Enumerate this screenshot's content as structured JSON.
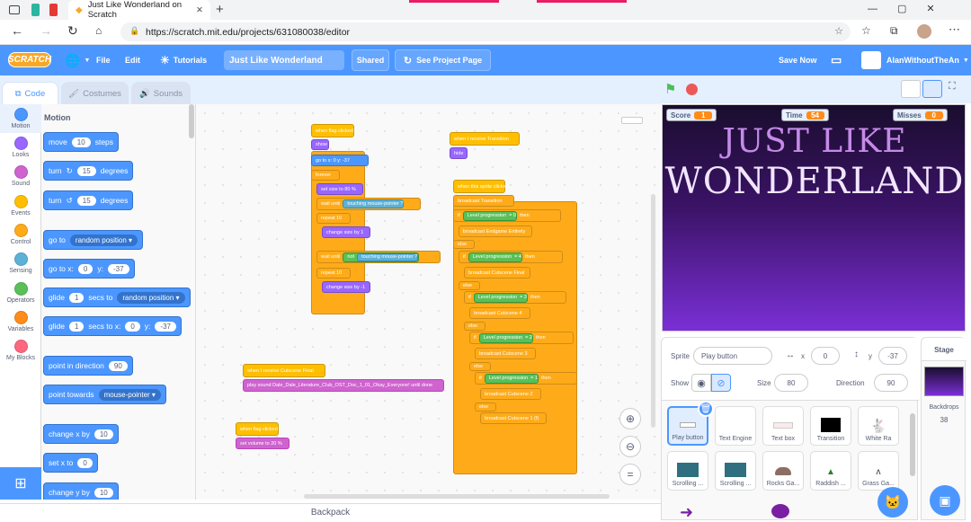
{
  "browser": {
    "tab_title": "Just Like Wonderland on Scratch",
    "url": "https://scratch.mit.edu/projects/631080038/editor"
  },
  "menu": {
    "file": "File",
    "edit": "Edit",
    "tutorials": "Tutorials",
    "project_title": "Just Like Wonderland",
    "shared": "Shared",
    "see_project": "See Project Page",
    "save_now": "Save Now",
    "username": "AlanWithoutTheAn"
  },
  "tabs": {
    "code": "Code",
    "costumes": "Costumes",
    "sounds": "Sounds"
  },
  "categories": [
    {
      "label": "Motion",
      "color": "#4c97ff"
    },
    {
      "label": "Looks",
      "color": "#9966ff"
    },
    {
      "label": "Sound",
      "color": "#cf63cf"
    },
    {
      "label": "Events",
      "color": "#ffbf00"
    },
    {
      "label": "Control",
      "color": "#ffab19"
    },
    {
      "label": "Sensing",
      "color": "#5cb1d6"
    },
    {
      "label": "Operators",
      "color": "#59c059"
    },
    {
      "label": "Variables",
      "color": "#ff8c1a"
    },
    {
      "label": "My Blocks",
      "color": "#ff6680"
    }
  ],
  "palette": {
    "heading": "Motion",
    "move": {
      "a": "move",
      "v": "10",
      "b": "steps"
    },
    "turn_right": {
      "a": "turn",
      "v": "15",
      "b": "degrees"
    },
    "turn_left": {
      "a": "turn",
      "v": "15",
      "b": "degrees"
    },
    "goto": {
      "a": "go to",
      "d": "random position"
    },
    "gotoxy": {
      "a": "go to x:",
      "x": "0",
      "b": "y:",
      "y": "-37"
    },
    "glide_to": {
      "a": "glide",
      "v": "1",
      "b": "secs to",
      "d": "random position"
    },
    "glide_xy": {
      "a": "glide",
      "v": "1",
      "b": "secs to x:",
      "x": "0",
      "c": "y:",
      "y": "-37"
    },
    "point_dir": {
      "a": "point in direction",
      "v": "90"
    },
    "point_towards": {
      "a": "point towards",
      "d": "mouse-pointer"
    },
    "change_x": {
      "a": "change x by",
      "v": "10"
    },
    "set_x": {
      "a": "set x to",
      "v": "0"
    },
    "change_y": {
      "a": "change y by",
      "v": "10"
    }
  },
  "scripts": {
    "s1": [
      "when flag clicked",
      "show",
      "go to x: 0 y: -37",
      "forever",
      "set size to 80 %",
      "wait until",
      "touching mouse-pointer ?",
      "repeat 10",
      "change size by 1",
      "wait until",
      "not",
      "touching mouse-pointer ?",
      "repeat 10",
      "change size by -1"
    ],
    "s2": [
      "when I receive Transition",
      "hide"
    ],
    "s3": [
      "when this sprite clicked",
      "broadcast Transition",
      "if",
      "Level progression",
      "= 0",
      "then",
      "broadcast Endgame Entirely",
      "else",
      "if",
      "Level progression",
      "= 4",
      "then",
      "broadcast Cutscene Final",
      "else",
      "if",
      "Level progression",
      "= 3",
      "then",
      "broadcast Cutscene 4",
      "else",
      "if",
      "Level progression",
      "= 2",
      "then",
      "broadcast Cutscene 3",
      "else",
      "if",
      "Level progression",
      "= 1",
      "then",
      "broadcast Cutscene 2",
      "else",
      "broadcast Cutscene 1 (f)"
    ],
    "s4": [
      "when I receive Cutscene Final",
      "play sound Dale_Dale_Literature_Club_OST_Doc_1_01_Okay_Everyone! until done"
    ],
    "s5": [
      "when flag clicked",
      "set volume to 20 %"
    ]
  },
  "backpack": "Backpack",
  "monitors": {
    "score_label": "Score",
    "score": "1",
    "time_label": "Time",
    "time": "54",
    "misses_label": "Misses",
    "misses": "0"
  },
  "stage_title": [
    "JUST LIKE",
    "WONDERLAND"
  ],
  "sprite_info": {
    "sprite_label": "Sprite",
    "name": "Play button",
    "x_label": "x",
    "x": "0",
    "y_label": "y",
    "y": "-37",
    "show_label": "Show",
    "size_label": "Size",
    "size": "80",
    "direction_label": "Direction",
    "direction": "90"
  },
  "sprites": [
    "Play button",
    "Text Engine",
    "Text box",
    "Transition",
    "White Ra",
    "Scrolling ...",
    "Scrolling ...",
    "Rocks Ga...",
    "Raddish ...",
    "Grass Ga..."
  ],
  "backdrops": {
    "title": "Stage",
    "label": "Backdrops",
    "count": "38"
  }
}
